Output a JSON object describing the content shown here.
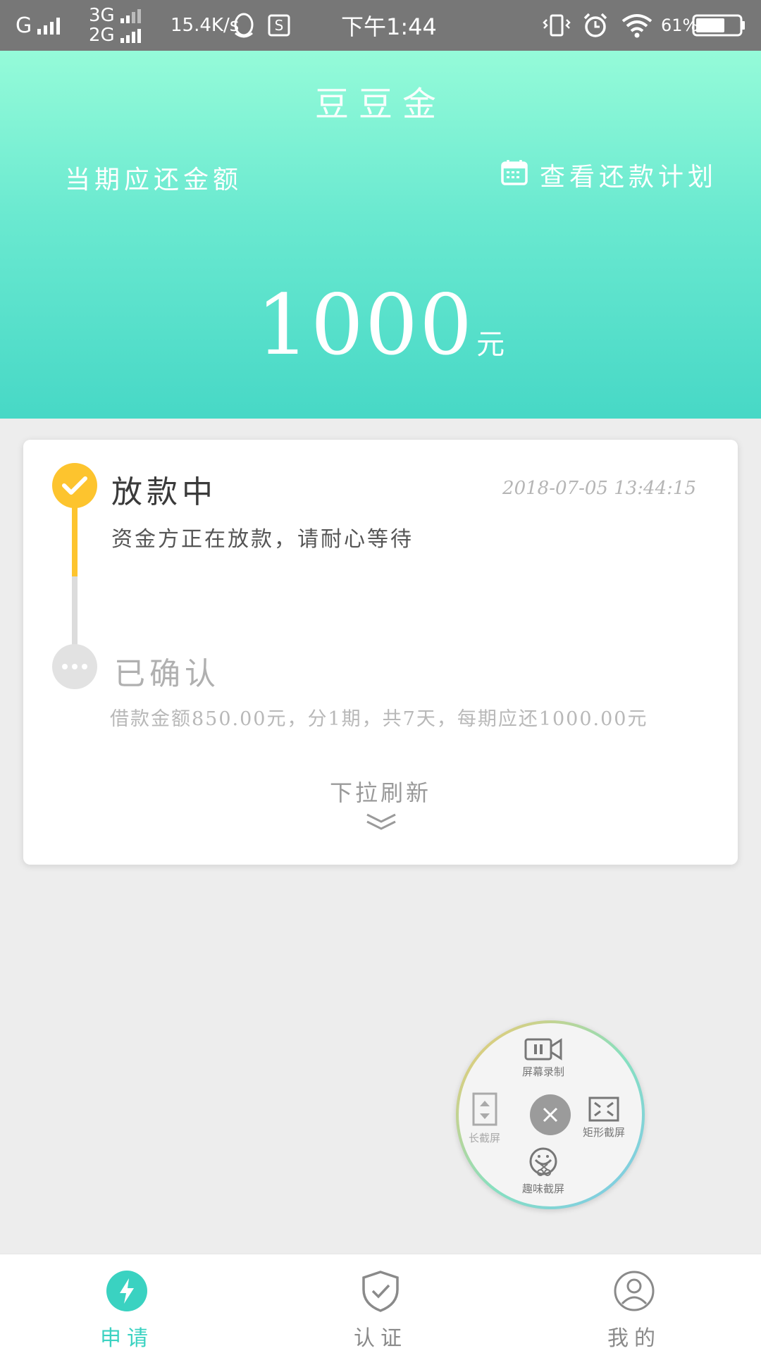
{
  "status_bar": {
    "carrier_g": "G",
    "net_3g": "3G",
    "net_2g": "2G",
    "speed": "15.4K/s",
    "time": "下午1:44",
    "battery": "61%"
  },
  "header": {
    "title": "豆豆金",
    "due_label": "当期应还金额",
    "plan_link": "查看还款计划",
    "amount": "1000",
    "amount_unit": "元"
  },
  "steps": [
    {
      "title": "放款中",
      "time": "2018-07-05 13:44:15",
      "description": "资金方正在放款，请耐心等待",
      "status": "done"
    },
    {
      "title": "已确认",
      "description": "借款金额850.00元，分1期，共7天，每期应还1000.00元",
      "status": "pending"
    }
  ],
  "pull_refresh": "下拉刷新",
  "screenshot_menu": {
    "record": "屏幕录制",
    "long": "长截屏",
    "rect": "矩形截屏",
    "fun": "趣味截屏"
  },
  "tabs": [
    {
      "label": "申请",
      "icon": "lightning-icon",
      "active": true
    },
    {
      "label": "认证",
      "icon": "shield-check-icon",
      "active": false
    },
    {
      "label": "我的",
      "icon": "user-icon",
      "active": false
    }
  ],
  "colors": {
    "accent": "#3ad2c1",
    "step_done": "#fdc42e",
    "step_pending": "#e2e2e2",
    "tab_inactive": "#8a8a8a"
  }
}
